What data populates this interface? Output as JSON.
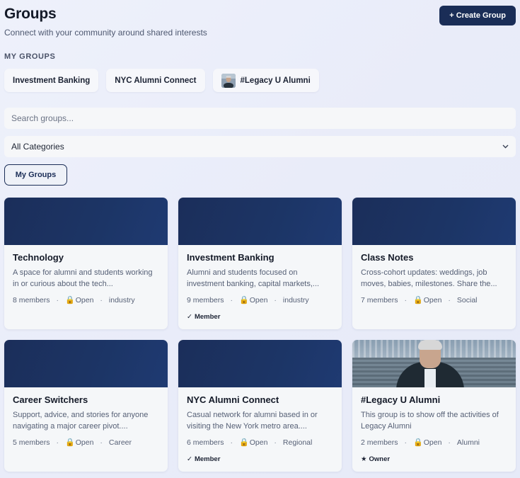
{
  "header": {
    "title": "Groups",
    "subtitle": "Connect with your community around shared interests",
    "create_label": "+ Create Group"
  },
  "my_groups": {
    "label": "MY GROUPS",
    "chips": [
      "Investment Banking",
      "NYC Alumni Connect",
      "#Legacy U Alumni"
    ]
  },
  "search": {
    "placeholder": "Search groups..."
  },
  "category": {
    "selected": "All Categories",
    "chevron": "chevron-down-icon"
  },
  "filter": {
    "my_groups_label": "My Groups"
  },
  "cards": [
    {
      "title": "Technology",
      "description": "A space for alumni and students working in or curious about the tech...",
      "members": "8 members",
      "privacy": "Open",
      "category": "industry",
      "badge": ""
    },
    {
      "title": "Investment Banking",
      "description": "Alumni and students focused on investment banking, capital markets,...",
      "members": "9 members",
      "privacy": "Open",
      "category": "industry",
      "badge": "Member"
    },
    {
      "title": "Class Notes",
      "description": "Cross-cohort updates: weddings, job moves, babies, milestones. Share the...",
      "members": "7 members",
      "privacy": "Open",
      "category": "Social",
      "badge": ""
    },
    {
      "title": "Career Switchers",
      "description": "Support, advice, and stories for anyone navigating a major career pivot....",
      "members": "5 members",
      "privacy": "Open",
      "category": "Career",
      "badge": ""
    },
    {
      "title": "NYC Alumni Connect",
      "description": "Casual network for alumni based in or visiting the New York metro area....",
      "members": "6 members",
      "privacy": "Open",
      "category": "Regional",
      "badge": "Member"
    },
    {
      "title": "#Legacy U Alumni",
      "description": "This group is to show off the activities of Legacy Alumni",
      "members": "2 members",
      "privacy": "Open",
      "category": "Alumni",
      "badge": "Owner"
    }
  ],
  "colors": {
    "primary": "#1a2d57",
    "banner": "#1c3566",
    "background": "#eceffa"
  }
}
